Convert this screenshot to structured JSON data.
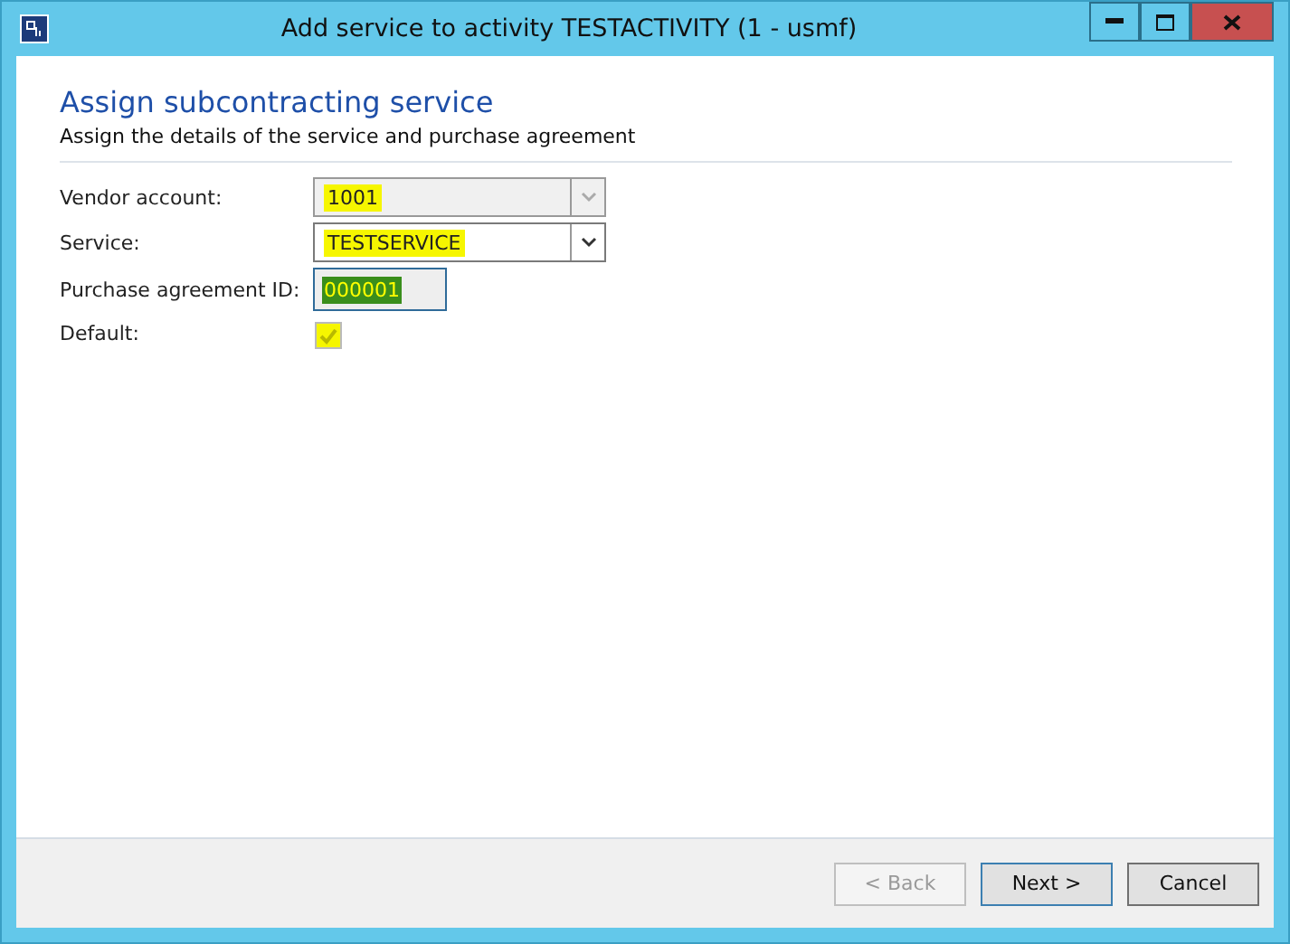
{
  "window": {
    "title": "Add service to activity TESTACTIVITY (1 - usmf)"
  },
  "header": {
    "title": "Assign subcontracting service",
    "subtitle": "Assign the details of the service and purchase agreement"
  },
  "fields": [
    {
      "kind": "dropdown",
      "label": "Vendor account:",
      "value": "1001",
      "disabled": true,
      "highlighted": true
    },
    {
      "kind": "dropdown",
      "label": "Service:",
      "value": "TESTSERVICE",
      "disabled": false,
      "highlighted": true
    },
    {
      "kind": "text",
      "label": "Purchase agreement ID:",
      "value": "000001",
      "selected": true
    },
    {
      "kind": "checkbox",
      "label": "Default:",
      "checked": true,
      "disabled": true,
      "highlighted": true
    }
  ],
  "buttons": [
    {
      "label": "< Back",
      "disabled": true,
      "selected": false
    },
    {
      "label": "Next >",
      "disabled": false,
      "selected": true
    },
    {
      "label": "Cancel",
      "disabled": false,
      "selected": false
    }
  ]
}
